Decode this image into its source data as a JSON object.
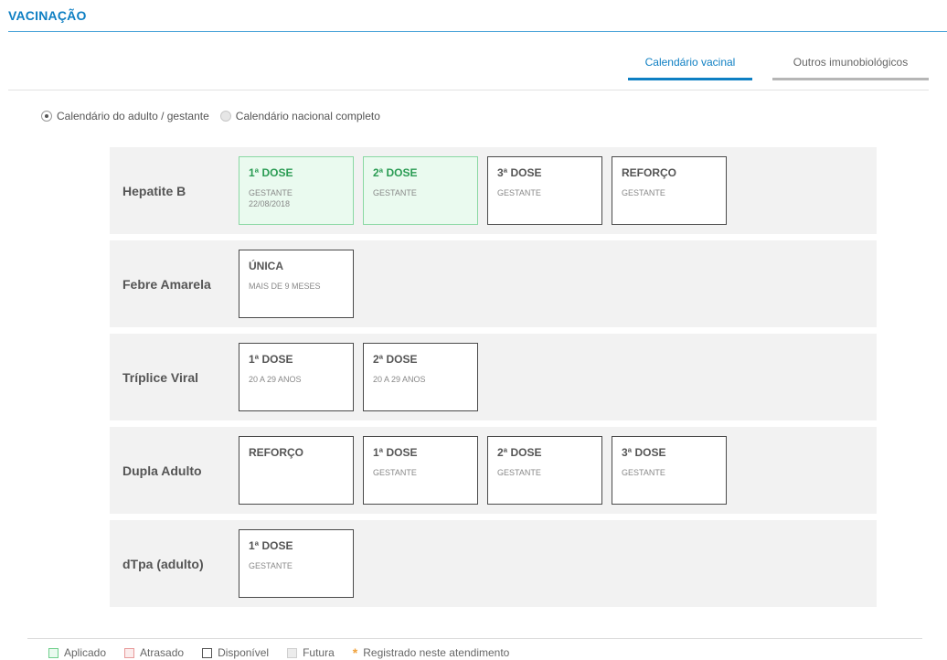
{
  "header": {
    "title": "VACINAÇÃO"
  },
  "tabs": [
    {
      "label": "Calendário vacinal",
      "active": true
    },
    {
      "label": "Outros imunobiológicos",
      "active": false
    }
  ],
  "calendar_options": [
    {
      "label": "Calendário do adulto / gestante",
      "selected": true
    },
    {
      "label": "Calendário nacional completo",
      "selected": false
    }
  ],
  "vaccines": [
    {
      "name": "Hepatite B",
      "doses": [
        {
          "title": "1ª DOSE",
          "subtitle": "GESTANTE",
          "date": "22/08/2018",
          "status": "aplicado"
        },
        {
          "title": "2ª DOSE",
          "subtitle": "GESTANTE",
          "date": "",
          "status": "aplicado"
        },
        {
          "title": "3ª DOSE",
          "subtitle": "GESTANTE",
          "date": "",
          "status": "disponivel"
        },
        {
          "title": "REFORÇO",
          "subtitle": "GESTANTE",
          "date": "",
          "status": "disponivel"
        }
      ]
    },
    {
      "name": "Febre Amarela",
      "doses": [
        {
          "title": "ÚNICA",
          "subtitle": "MAIS DE 9 MESES",
          "date": "",
          "status": "disponivel"
        }
      ]
    },
    {
      "name": "Tríplice Viral",
      "doses": [
        {
          "title": "1ª DOSE",
          "subtitle": "20 A 29 ANOS",
          "date": "",
          "status": "disponivel"
        },
        {
          "title": "2ª DOSE",
          "subtitle": "20 A 29 ANOS",
          "date": "",
          "status": "disponivel"
        }
      ]
    },
    {
      "name": "Dupla Adulto",
      "doses": [
        {
          "title": "REFORÇO",
          "subtitle": "",
          "date": "",
          "status": "disponivel"
        },
        {
          "title": "1ª DOSE",
          "subtitle": "GESTANTE",
          "date": "",
          "status": "disponivel"
        },
        {
          "title": "2ª DOSE",
          "subtitle": "GESTANTE",
          "date": "",
          "status": "disponivel"
        },
        {
          "title": "3ª DOSE",
          "subtitle": "GESTANTE",
          "date": "",
          "status": "disponivel"
        }
      ]
    },
    {
      "name": "dTpa (adulto)",
      "doses": [
        {
          "title": "1ª DOSE",
          "subtitle": "GESTANTE",
          "date": "",
          "status": "disponivel"
        }
      ]
    }
  ],
  "legend": {
    "aplicado": "Aplicado",
    "atrasado": "Atrasado",
    "disponivel": "Disponível",
    "futura": "Futura",
    "registrado": "Registrado neste atendimento",
    "registrado_symbol": "*"
  },
  "colors": {
    "accent": "#0e7fc3",
    "applied_border": "#8ad8a3",
    "applied_bg": "#eafaef",
    "late_border": "#e89a9a",
    "registered_asterisk": "#f0a23c"
  }
}
